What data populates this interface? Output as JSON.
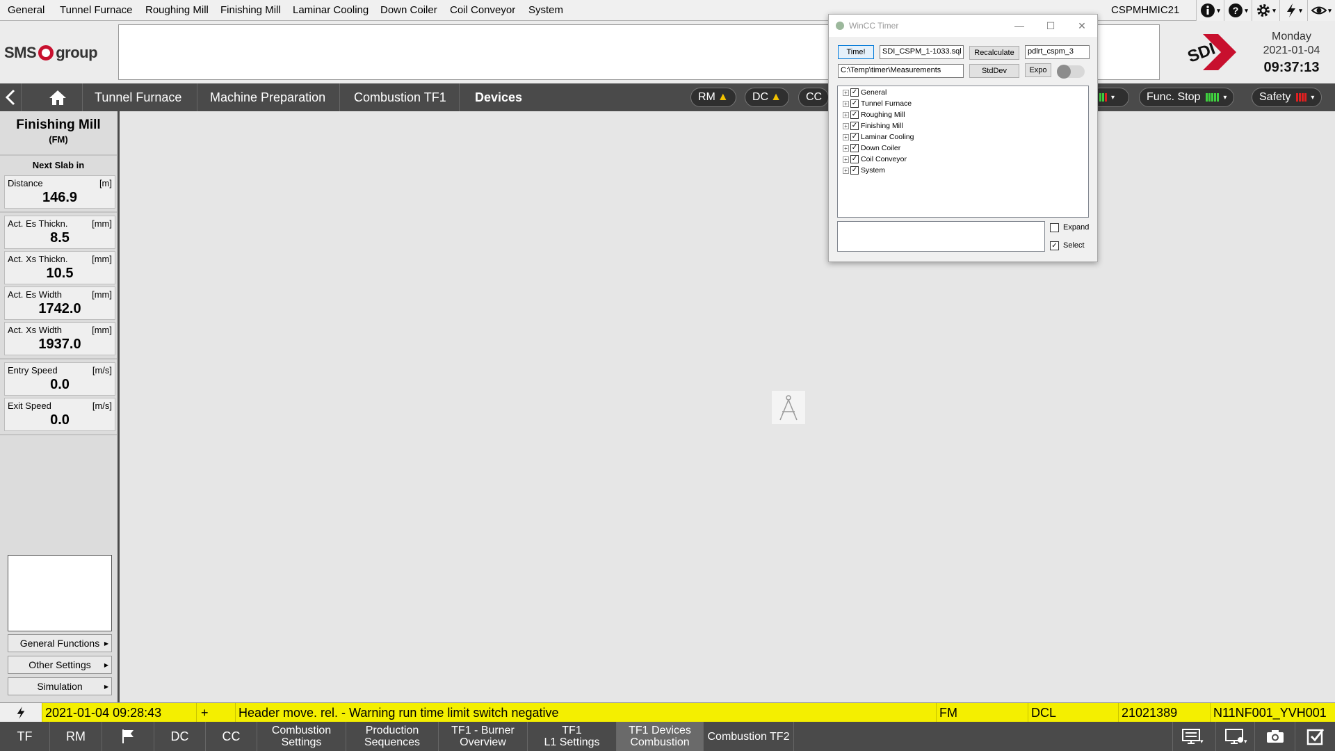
{
  "top_menu": {
    "items": [
      "General",
      "Tunnel Furnace",
      "Roughing Mill",
      "Finishing Mill",
      "Laminar Cooling",
      "Down Coiler",
      "Coil Conveyor",
      "System"
    ],
    "hostname": "CSPMHMIC21"
  },
  "top_icons": [
    "info-icon",
    "help-icon",
    "gear-icon",
    "lightning-icon",
    "eye-icon"
  ],
  "header": {
    "sms_logo_text_left": "SMS",
    "sms_logo_text_right": "group",
    "sdi_logo": "SDI",
    "day": "Monday",
    "date": "2021-01-04",
    "time": "09:37:13"
  },
  "nav": {
    "breadcrumbs": [
      "Tunnel Furnace",
      "Machine Preparation",
      "Combustion TF1",
      "Devices"
    ],
    "status_pills": {
      "rm": "RM",
      "dc": "DC",
      "cc": "CC",
      "func_stop": "Func. Stop",
      "safety": "Safety"
    }
  },
  "colors": {
    "alarm_yellow": "#f4ef00",
    "nav_dark": "#4a4a4a",
    "status_green": "#3fd13f",
    "status_red": "#e02020",
    "warning": "#f2c200",
    "sdi_red": "#c8102e"
  },
  "left_panel": {
    "title": "Finishing Mill",
    "subtitle": "(FM)",
    "next_slab_label": "Next Slab in",
    "values": [
      {
        "label": "Distance",
        "unit": "[m]",
        "value": "146.9"
      },
      {
        "label": "Act. Es Thickn.",
        "unit": "[mm]",
        "value": "8.5"
      },
      {
        "label": "Act. Xs Thickn.",
        "unit": "[mm]",
        "value": "10.5"
      },
      {
        "label": "Act. Es Width",
        "unit": "[mm]",
        "value": "1742.0"
      },
      {
        "label": "Act. Xs Width",
        "unit": "[mm]",
        "value": "1937.0"
      },
      {
        "label": "Entry Speed",
        "unit": "[m/s]",
        "value": "0.0"
      },
      {
        "label": "Exit Speed",
        "unit": "[m/s]",
        "value": "0.0"
      }
    ],
    "buttons": [
      "General Functions",
      "Other Settings",
      "Simulation"
    ]
  },
  "dialog": {
    "title": "WinCC Timer",
    "time_button": "Time!",
    "file_input": "SDI_CSPM_1-1033.sql",
    "recalculate_button": "Recalculate",
    "db_input": "pdlrt_cspm_3",
    "path_input": "C:\\Temp\\timer\\Measurements",
    "stddev_button": "StdDev",
    "expo_button": "Expo",
    "tree_items": [
      "General",
      "Tunnel Furnace",
      "Roughing Mill",
      "Finishing Mill",
      "Laminar Cooling",
      "Down Coiler",
      "Coil Conveyor",
      "System"
    ],
    "expand_label": "Expand",
    "expand_checked": false,
    "select_label": "Select",
    "select_checked": true
  },
  "alarm": {
    "datetime": "2021-01-04 09:28:43",
    "state": "+",
    "message": "Header move. rel. - Warning run time limit switch negative",
    "area": "FM",
    "unit": "DCL",
    "number": "21021389",
    "tag": "N11NF001_YVH001"
  },
  "bottom": {
    "area_buttons": [
      "TF",
      "RM",
      "DC",
      "CC"
    ],
    "nav_buttons": [
      {
        "line1": "Combustion",
        "line2": "Settings"
      },
      {
        "line1": "Production",
        "line2": "Sequences"
      },
      {
        "line1": "TF1 - Burner",
        "line2": "Overview"
      },
      {
        "line1": "TF1",
        "line2": "L1 Settings"
      },
      {
        "line1": "TF1 Devices",
        "line2": "Combustion"
      },
      {
        "line1": "Combustion TF2",
        "line2": ""
      }
    ],
    "active_nav_index": 4
  }
}
